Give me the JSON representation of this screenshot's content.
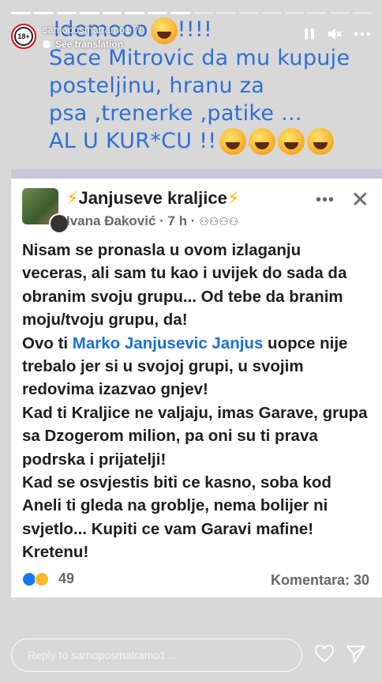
{
  "story": {
    "progress_total": 16,
    "progress_done": 8,
    "username": "samoposmatramo1",
    "time": "7h",
    "translate_label": "See translation",
    "avatar_label": "18+"
  },
  "overlay_text": {
    "lines": [
      "Idemooo",
      "Sace Mitrovic da mu kupuje",
      "posteljinu, hranu za",
      "psa ,trenerke ,patike ...",
      "AL U KUR*CU !!"
    ],
    "suffix_1": "!!!!"
  },
  "fb_post": {
    "group_name": "Janjuseve kraljice",
    "bolt": "⚡",
    "author": "Ivana Đaković",
    "time": "· 7 h ·",
    "more": "•••",
    "close": "✕",
    "p1": "Nisam se pronasla u ovom izlaganju veceras, ali sam tu kao i uvijek do sada da obranim svoju grupu... Od tebe da branim moju/tvoju grupu, da!",
    "p2_before": "Ovo ti ",
    "p2_mention": "Marko Janjusevic Janjus",
    "p2_after": " uopce nije trebalo jer si u svojoj grupi, u svojim redovima izazvao gnjev!",
    "p3": "Kad ti Kraljice ne valjaju, imas Garave, grupa sa Dzogerom milion, pa oni su ti prava podrska i prijatelji!",
    "p4": "Kad se osvjestis biti ce kasno, soba kod Aneli ti gleda na groblje, nema bolijer ni svjetlo... Kupiti ce vam Garavi mafine! Kretenu!",
    "reactions_count": "49",
    "comments": "Komentara: 30"
  },
  "reply": {
    "placeholder": "Reply to samoposmatramo1..."
  },
  "colors": {
    "overlay_text": "#2f6fd6",
    "mention": "#1a6fd8",
    "card_bg": "#ffffff"
  }
}
